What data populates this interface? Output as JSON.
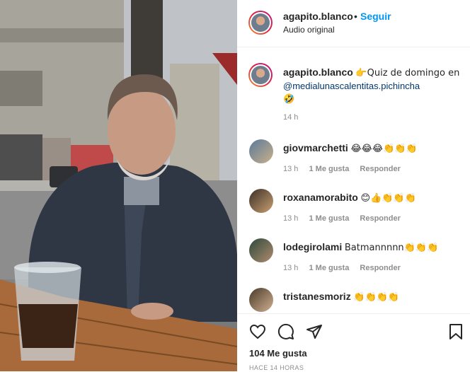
{
  "header": {
    "username": "agapito.blanco",
    "separator": "•",
    "follow_label": "Seguir",
    "subtitle": "Audio original"
  },
  "caption": {
    "username": "agapito.blanco",
    "text_before": "👉Quiz de domingo en ",
    "mention": "@medialunascalentitas.pichincha",
    "emoji": "🤣",
    "time": "14 h"
  },
  "comments": [
    {
      "username": "giovmarchetti",
      "text": "😂😂😂👏👏👏",
      "time": "13 h",
      "likes": "1 Me gusta",
      "reply": "Responder"
    },
    {
      "username": "roxanamorabito",
      "text": "😊👍👏👏👏",
      "time": "13 h",
      "likes": "1 Me gusta",
      "reply": "Responder"
    },
    {
      "username": "lodegirolami",
      "text": "Batmannnnn👏👏👏",
      "time": "13 h",
      "likes": "1 Me gusta",
      "reply": "Responder"
    },
    {
      "username": "tristanesmoriz",
      "text": "👏👏👏👏",
      "time": "",
      "likes": "",
      "reply": ""
    }
  ],
  "actions": {
    "icons": [
      "heart-icon",
      "comment-icon",
      "share-icon",
      "bookmark-icon"
    ],
    "likes": "104 Me gusta",
    "age": "HACE 14 HORAS"
  },
  "colors": {
    "link": "#0095f6",
    "mention": "#00376b",
    "muted": "#8e8e8e",
    "text": "#262626"
  }
}
